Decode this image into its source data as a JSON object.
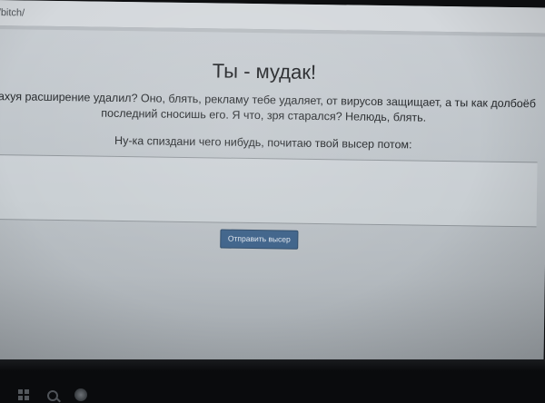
{
  "browser": {
    "url": "/bitch/"
  },
  "page": {
    "title": "Ты - мудак!",
    "message_line1": "нахуя расширение удалил? Оно, блять, рекламу тебе удаляет, от вирусов защищает, а ты как долбоёб",
    "message_line2": "последний сносишь его. Я что, зря старался? Нелюдь, блять.",
    "prompt": "Ну-ка спиздани чего нибудь, почитаю твой высер потом:",
    "textarea_value": "",
    "send_button_label": "Отправить высер"
  },
  "taskbar": {
    "icons": [
      "windows-start-icon",
      "search-icon",
      "task-view-icon"
    ]
  },
  "colors": {
    "screen_bg": "#c3c8cd",
    "button_bg": "#3a5f87",
    "text": "#1f2124",
    "taskbar": "#0a0b0d"
  }
}
